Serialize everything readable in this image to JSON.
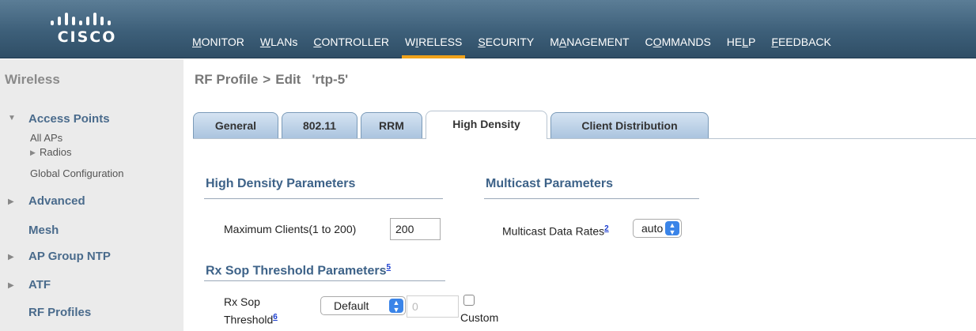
{
  "logo": {
    "text": "CISCO"
  },
  "nav": [
    {
      "pre": "",
      "ul": "M",
      "post": "ONITOR",
      "active": false
    },
    {
      "pre": "",
      "ul": "W",
      "post": "LANs",
      "active": false
    },
    {
      "pre": "",
      "ul": "C",
      "post": "ONTROLLER",
      "active": false
    },
    {
      "pre": "W",
      "ul": "I",
      "post": "RELESS",
      "active": true
    },
    {
      "pre": "",
      "ul": "S",
      "post": "ECURITY",
      "active": false
    },
    {
      "pre": "M",
      "ul": "A",
      "post": "NAGEMENT",
      "active": false
    },
    {
      "pre": "C",
      "ul": "O",
      "post": "MMANDS",
      "active": false
    },
    {
      "pre": "HE",
      "ul": "L",
      "post": "P",
      "active": false
    },
    {
      "pre": "",
      "ul": "F",
      "post": "EEDBACK",
      "active": false
    }
  ],
  "sidebar": {
    "title": "Wireless",
    "access_points": "Access Points",
    "all_aps": "All APs",
    "radios": "Radios",
    "global_config": "Global Configuration",
    "advanced": "Advanced",
    "mesh": "Mesh",
    "ap_group_ntp": "AP Group NTP",
    "atf": "ATF",
    "rf_profiles": "RF Profiles"
  },
  "page": {
    "crumb": "RF Profile",
    "sep": ">",
    "action": "Edit",
    "name": "'rtp-5'"
  },
  "tabs": [
    "General",
    "802.11",
    "RRM",
    "High Density",
    "Client Distribution"
  ],
  "high_density": {
    "title": "High Density Parameters",
    "max_clients_label": "Maximum Clients(1 to 200)",
    "max_clients_value": "200"
  },
  "multicast": {
    "title": "Multicast Parameters",
    "data_rates_label": "Multicast Data Rates",
    "data_rates_footnote": "2",
    "data_rates_value": "auto"
  },
  "rx_sop": {
    "title": "Rx Sop Threshold Parameters",
    "title_footnote": "5",
    "label_line1": "Rx Sop",
    "label_line2": "Threshold",
    "label_footnote": "6",
    "select_value": "Default",
    "input_value": "0",
    "custom_label": "Custom"
  },
  "colors": {
    "topbar": "#3d5f79",
    "active_nav": "#f0a21a",
    "section_heading": "#3d6288",
    "sidebar_link": "#4a6b8c"
  }
}
